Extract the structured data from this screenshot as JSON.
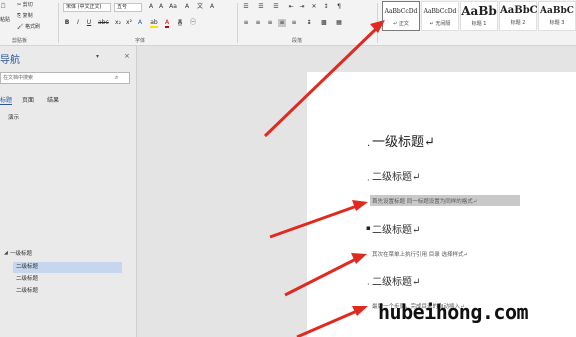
{
  "ribbon": {
    "clipboard": {
      "cut": "剪切",
      "copy": "复制",
      "format_painter": "格式刷",
      "paste": "粘贴",
      "group_label": "剪贴板"
    },
    "font": {
      "name": "宋体 (中文正文)",
      "size": "五号",
      "group_label": "字体"
    },
    "paragraph": {
      "group_label": "段落"
    },
    "styles": [
      {
        "sample": "AaBbCcDd",
        "name": "↵ 正文",
        "active": true
      },
      {
        "sample": "AaBbCcDd",
        "name": "↵ 无间隔",
        "active": false
      },
      {
        "sample": "AaBb",
        "name": "标题 1",
        "active": false
      },
      {
        "sample": "AaBbC",
        "name": "标题 2",
        "active": false
      },
      {
        "sample": "AaBbC",
        "name": "标题 3",
        "active": false
      }
    ]
  },
  "nav": {
    "title": "导航",
    "search_placeholder": "在文档中搜索",
    "tabs": [
      "标题",
      "页面",
      "结果"
    ],
    "demo": "演示",
    "tree": [
      "一级标题",
      "二级标题",
      "二级标题",
      "二级标题"
    ]
  },
  "doc": {
    "h1": "一级标题↵",
    "h2a": "二级标题↵",
    "para1": "首先设置标题 同一标题设置为同样的格式↵",
    "h2b": "二级标题↵",
    "para2": "其次在菜单上执行引用 目录 选择样式↵",
    "h2c": "二级标题↵",
    "para3": "最后一个步骤，完成目录的自动插入↵"
  },
  "watermark": "hubeihong.com",
  "colors": {
    "accent": "#2b579a",
    "arrow": "#e02a20",
    "selection": "#c5d6ee"
  }
}
